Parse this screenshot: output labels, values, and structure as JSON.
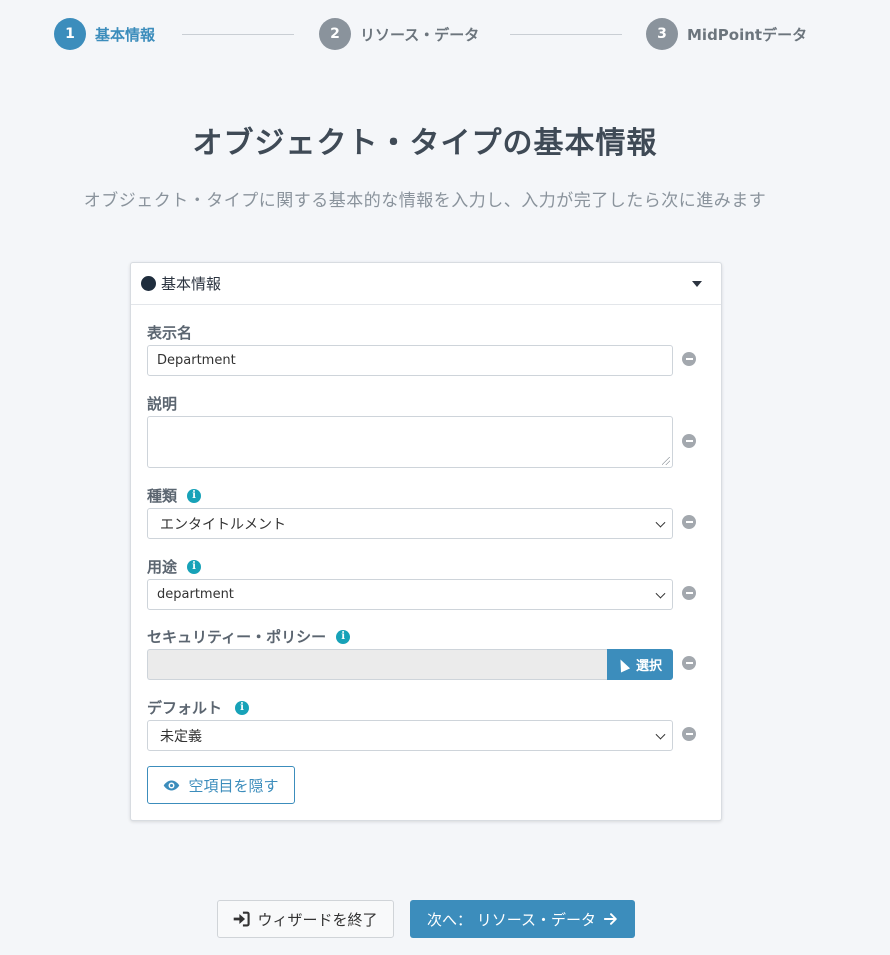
{
  "stepper": {
    "steps": [
      {
        "number": "1",
        "label": "基本情報",
        "state": "active"
      },
      {
        "number": "2",
        "label": "リソース・データ",
        "state": "inactive"
      },
      {
        "number": "3",
        "label": "MidPointデータ",
        "state": "inactive"
      }
    ]
  },
  "header": {
    "title": "オブジェクト・タイプの基本情報",
    "subtitle": "オブジェクト・タイプに関する基本的な情報を入力し、入力が完了したら次に進みます"
  },
  "card": {
    "title": "基本情報",
    "fields": {
      "display_name": {
        "label": "表示名",
        "value": "Department"
      },
      "description": {
        "label": "説明",
        "value": ""
      },
      "kind": {
        "label": "種類",
        "selected": "エンタイトルメント"
      },
      "intent": {
        "label": "用途",
        "selected": "department"
      },
      "security_policy": {
        "label": "セキュリティー・ポリシー",
        "value": "",
        "button_label": "選択"
      },
      "default": {
        "label": "デフォルト",
        "selected": "未定義"
      }
    },
    "hide_empty_label": "空項目を隠す"
  },
  "footer": {
    "exit_label": "ウィザードを終了",
    "next_label": "次へ： リソース・データ"
  },
  "colors": {
    "primary": "#3c8dbc",
    "info": "#17a2b8",
    "inactive_step": "#8a939c",
    "background": "#f4f6f9"
  }
}
